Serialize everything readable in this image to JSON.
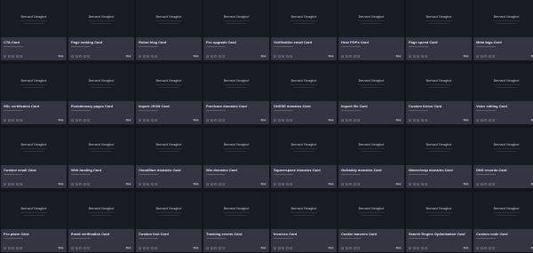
{
  "preview_author": "Bernard Neagbot",
  "badge_label": "Free",
  "cards": [
    {
      "title": "CTA Card"
    },
    {
      "title": "Page ranking Card"
    },
    {
      "title": "Robot blog Card"
    },
    {
      "title": "Pro upgrade Card"
    },
    {
      "title": "Verification email Card"
    },
    {
      "title": "Host PGPs Card"
    },
    {
      "title": "Page speed Card"
    },
    {
      "title": "Meta tags Card"
    },
    {
      "title": "SSL certificates Card"
    },
    {
      "title": "Evolutionary pages Card"
    },
    {
      "title": "Import JSON Card"
    },
    {
      "title": "Purchase domains Card"
    },
    {
      "title": "DNSSE domains Card"
    },
    {
      "title": "Import file Card"
    },
    {
      "title": "Custom forms Card"
    },
    {
      "title": "Voice editing Card"
    },
    {
      "title": "Custom email Card"
    },
    {
      "title": "Web hosting Card"
    },
    {
      "title": "Cloudflare domains Card"
    },
    {
      "title": "Wix domains Card"
    },
    {
      "title": "Squarespace domains Card"
    },
    {
      "title": "GoDaddy domains Card"
    },
    {
      "title": "Wavecheap domains Card"
    },
    {
      "title": "DNS records Card"
    },
    {
      "title": "Pro plans Card"
    },
    {
      "title": "Email verification Card"
    },
    {
      "title": "Custom font Card"
    },
    {
      "title": "Tracking events Card"
    },
    {
      "title": "Invoices Card"
    },
    {
      "title": "Cookie banners Card"
    },
    {
      "title": "Search Engine Optimisation Card"
    },
    {
      "title": "Custom code Card"
    }
  ]
}
